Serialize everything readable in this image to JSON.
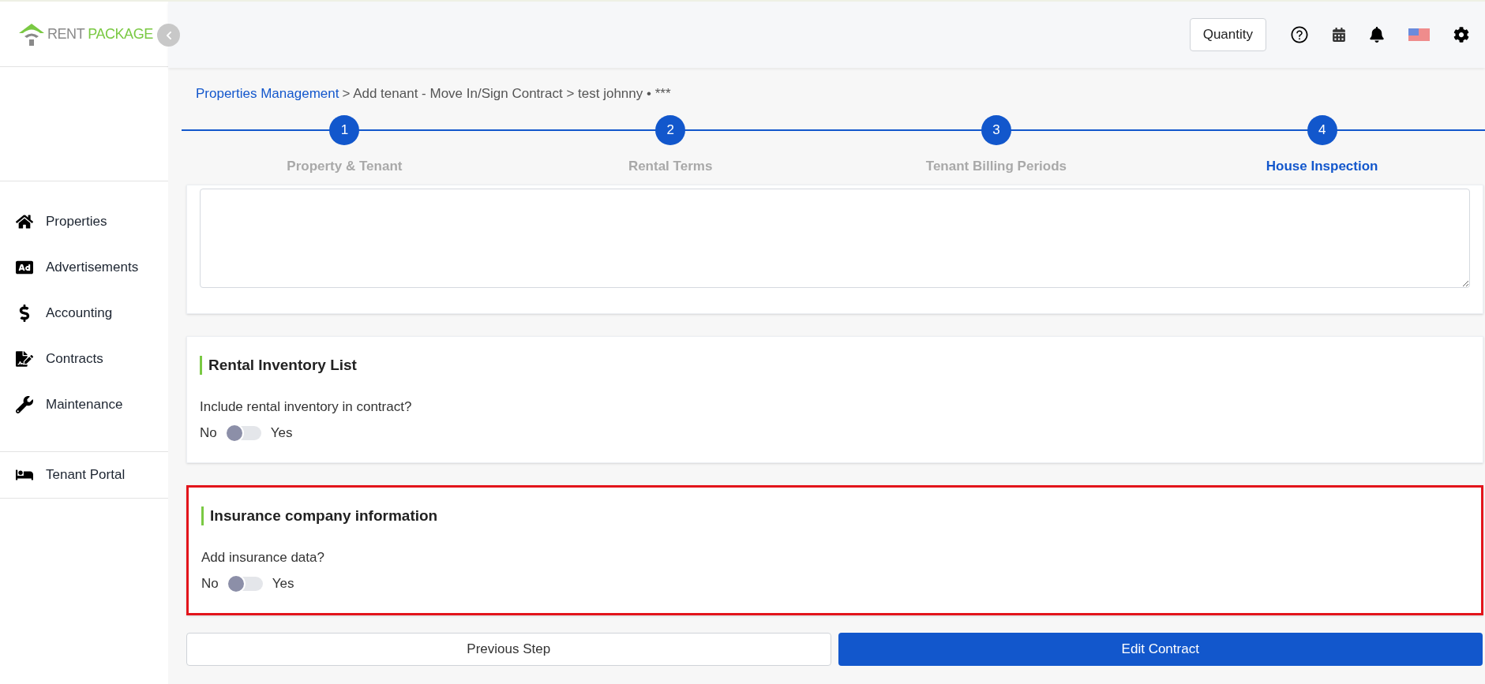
{
  "brand": {
    "first": "RENT",
    "second": "PACKAGE"
  },
  "header": {
    "quantity_button": "Quantity"
  },
  "sidebar": {
    "items": [
      {
        "label": "Properties"
      },
      {
        "label": "Advertisements"
      },
      {
        "label": "Accounting"
      },
      {
        "label": "Contracts"
      },
      {
        "label": "Maintenance"
      }
    ],
    "footer_items": [
      {
        "label": "Tenant Portal"
      }
    ]
  },
  "breadcrumb": {
    "link": "Properties Management",
    "rest": "> Add tenant - Move In/Sign Contract > test johnny • ***"
  },
  "steps": [
    {
      "number": "1",
      "label": "Property & Tenant",
      "selected": false
    },
    {
      "number": "2",
      "label": "Rental Terms",
      "selected": false
    },
    {
      "number": "3",
      "label": "Tenant Billing Periods",
      "selected": false
    },
    {
      "number": "4",
      "label": "House Inspection",
      "selected": true
    }
  ],
  "sections": [
    {
      "kind": "textarea",
      "highlighted": false
    },
    {
      "kind": "toggle",
      "title": "Rental Inventory List",
      "question": "Include rental inventory in contract?",
      "off_label": "No",
      "on_label": "Yes",
      "on": false,
      "highlighted": false
    },
    {
      "kind": "toggle",
      "title": "Insurance company information",
      "question": "Add insurance data?",
      "off_label": "No",
      "on_label": "Yes",
      "on": false,
      "highlighted": true
    }
  ],
  "buttons": {
    "previous": "Previous Step",
    "primary": "Edit Contract"
  }
}
